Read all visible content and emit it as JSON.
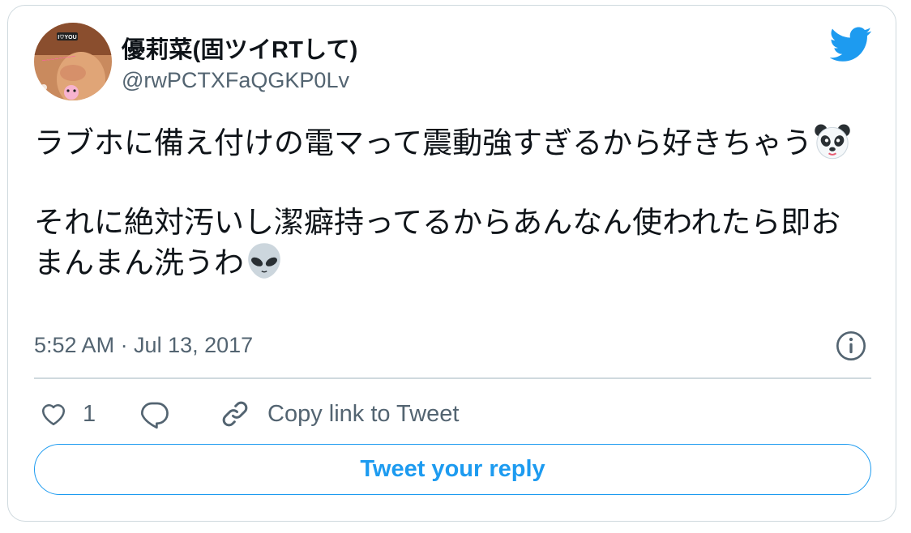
{
  "author": {
    "display_name": "優莉菜(固ツイRTして)",
    "handle": "@rwPCTXFaQGKP0Lv",
    "avatar_text": "I♡YOU"
  },
  "tweet": {
    "paragraphs": [
      {
        "text": "ラブホに備え付けの電マって震動強すぎるから好きちゃう",
        "emoji": "panda-face-emoji"
      },
      {
        "text": "それに絶対汚いし潔癖持ってるからあんなん使われたら即おまんまん洗うわ",
        "emoji": "alien-emoji"
      }
    ],
    "timestamp": "5:52 AM · Jul 13, 2017"
  },
  "actions": {
    "like_count": "1",
    "copy_link_label": "Copy link to Tweet",
    "reply_button_label": "Tweet your reply"
  },
  "colors": {
    "accent": "#1d9bf0",
    "secondary_text": "#536471",
    "border": "#cfd9de"
  },
  "icons": [
    "twitter-bird-icon",
    "info-icon",
    "heart-icon",
    "reply-icon",
    "link-icon"
  ]
}
